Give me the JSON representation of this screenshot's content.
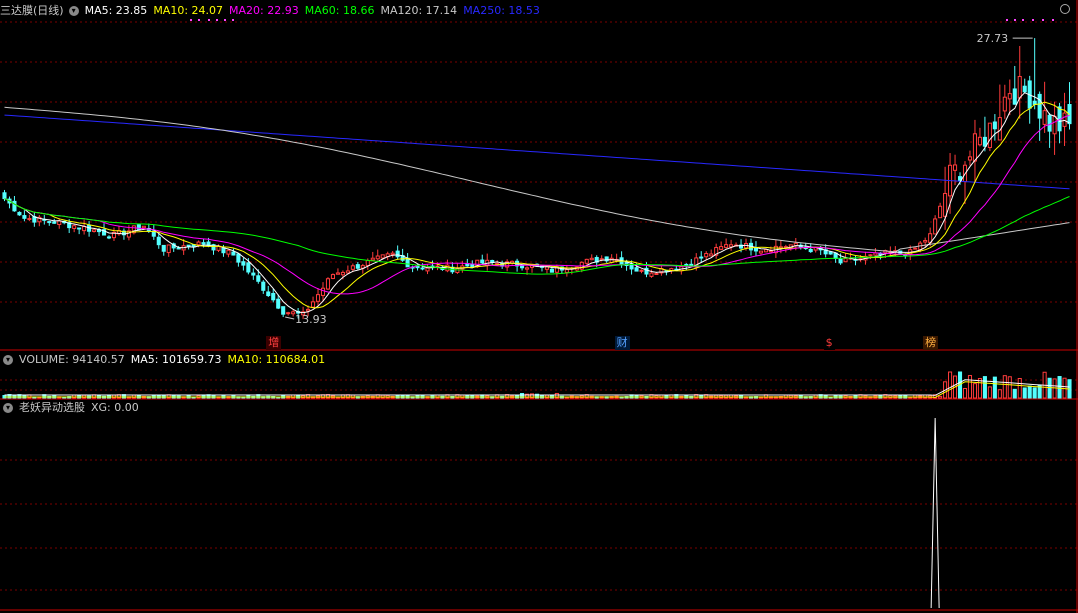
{
  "colors": {
    "up": "#ff3c3c",
    "down": "#54ffff",
    "ma5": "#ffffff",
    "ma10": "#ffff00",
    "ma20": "#ff00ff",
    "ma60": "#00ff00",
    "ma120": "#c8c8c8",
    "ma250": "#2828ff",
    "grid": "#7a0000",
    "divider": "#cc0000",
    "text": "#c8c8c8"
  },
  "main_legend": {
    "title": "三达膜(日线)",
    "ma5": "MA5: 23.85",
    "ma10": "MA10: 24.07",
    "ma20": "MA20: 22.93",
    "ma60": "MA60: 18.66",
    "ma120": "MA120: 17.14",
    "ma250": "MA250: 18.53"
  },
  "annotations": {
    "high_label": "27.73",
    "low_label": "13.93"
  },
  "event_marks": [
    {
      "text": "增",
      "color": "#ff4040",
      "bg": "#3a0000",
      "day": 54
    },
    {
      "text": "财",
      "color": "#54a0ff",
      "bg": "#001a3a",
      "day": 124
    },
    {
      "text": "$",
      "color": "#ff3c3c",
      "bg": "#000000",
      "day": 166
    },
    {
      "text": "榜",
      "color": "#ffb040",
      "bg": "#3a1800",
      "day": 186
    }
  ],
  "volume_legend": {
    "title": "VOLUME: 94140.57",
    "ma5": "MA5: 101659.73",
    "ma10": "MA10: 110684.01"
  },
  "indicator_legend": {
    "title": "老妖异动选股",
    "xg": "XG: 0.00"
  },
  "chart_data": [
    {
      "type": "candlestick",
      "title": "三达膜(日线)",
      "days": 215,
      "ylim": [
        12.5,
        29.5
      ],
      "anchors": [
        [
          0,
          20.2
        ],
        [
          4,
          19.2
        ],
        [
          10,
          19.0
        ],
        [
          16,
          18.7
        ],
        [
          22,
          18.3
        ],
        [
          28,
          18.8
        ],
        [
          32,
          17.6
        ],
        [
          40,
          17.9
        ],
        [
          46,
          17.3
        ],
        [
          52,
          15.6
        ],
        [
          56,
          14.4
        ],
        [
          60,
          14.2
        ],
        [
          66,
          16.3
        ],
        [
          74,
          17.0
        ],
        [
          78,
          17.3
        ],
        [
          82,
          16.7
        ],
        [
          90,
          16.6
        ],
        [
          96,
          16.9
        ],
        [
          104,
          16.8
        ],
        [
          110,
          16.5
        ],
        [
          116,
          16.9
        ],
        [
          122,
          17.2
        ],
        [
          128,
          16.4
        ],
        [
          136,
          16.7
        ],
        [
          142,
          17.4
        ],
        [
          146,
          17.9
        ],
        [
          152,
          17.6
        ],
        [
          158,
          17.8
        ],
        [
          164,
          17.5
        ],
        [
          168,
          16.9
        ],
        [
          172,
          17.1
        ],
        [
          178,
          17.4
        ],
        [
          182,
          17.4
        ],
        [
          186,
          18.3
        ],
        [
          190,
          21.3
        ],
        [
          194,
          22.4
        ],
        [
          198,
          23.8
        ],
        [
          202,
          25.9
        ],
        [
          206,
          25.6
        ],
        [
          210,
          24.1
        ],
        [
          214,
          23.9
        ]
      ],
      "high_label": "27.73",
      "low_label": "13.93"
    },
    {
      "type": "bar",
      "title": "VOLUME: 94140.57",
      "vol_ma5": 101659.73,
      "vol_ma10": 110684.01
    },
    {
      "type": "line",
      "title": "老妖异动选股",
      "series": [
        {
          "name": "XG",
          "spike_day": 187,
          "value": 1
        }
      ]
    }
  ]
}
